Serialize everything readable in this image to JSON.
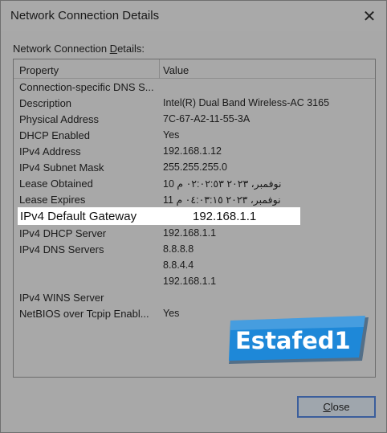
{
  "window": {
    "title": "Network Connection Details",
    "close_glyph": "✕"
  },
  "group_label": {
    "before": "Network Connection ",
    "accel": "D",
    "after": "etails:"
  },
  "list": {
    "header_property": "Property",
    "header_value": "Value",
    "rows": [
      {
        "property": "Connection-specific DNS S...",
        "value": ""
      },
      {
        "property": "Description",
        "value": "Intel(R) Dual Band Wireless-AC 3165"
      },
      {
        "property": "Physical Address",
        "value": "7C-67-A2-11-55-3A"
      },
      {
        "property": "DHCP Enabled",
        "value": "Yes"
      },
      {
        "property": "IPv4 Address",
        "value": "192.168.1.12"
      },
      {
        "property": "IPv4 Subnet Mask",
        "value": "255.255.255.0"
      },
      {
        "property": "Lease Obtained",
        "value": "نوفمبر، ٢٠٢٣ ٠٢:٠٢:٥٣ م 10"
      },
      {
        "property": "Lease Expires",
        "value": "نوفمبر، ٢٠٢٣ ٠٤:٠٣:١٥ م 11"
      },
      {
        "property": "IPv4 Default Gateway",
        "value": "192.168.1.1"
      },
      {
        "property": "IPv4 DHCP Server",
        "value": "192.168.1.1"
      },
      {
        "property": "IPv4 DNS Servers",
        "value": "8.8.8.8"
      },
      {
        "property": "",
        "value": "8.8.4.4"
      },
      {
        "property": "",
        "value": "192.168.1.1"
      },
      {
        "property": "IPv4 WINS Server",
        "value": ""
      },
      {
        "property": "NetBIOS over Tcpip Enabl...",
        "value": "Yes"
      }
    ]
  },
  "watermark": {
    "text": "Estafed1",
    "color": "#1e88d8"
  },
  "close_button": {
    "accel": "C",
    "rest": "lose"
  },
  "colors": {
    "background": "#a8a8a8",
    "highlight": "#ffffff",
    "button_border": "#3b5e9c",
    "logo_blue": "#1e88d8"
  }
}
